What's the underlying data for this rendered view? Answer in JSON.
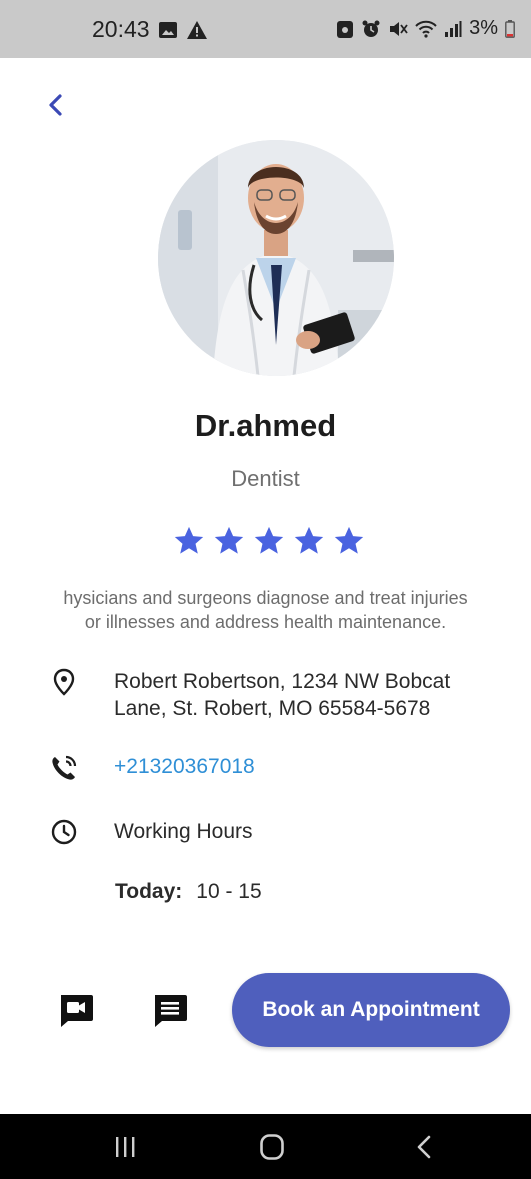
{
  "status_bar": {
    "time": "20:43",
    "battery": "3%"
  },
  "doctor": {
    "name": "Dr.ahmed",
    "specialty": "Dentist",
    "rating": 5,
    "rating_max": 5,
    "bio_line1": "hysicians and surgeons diagnose and treat injuries",
    "bio_line2": "or illnesses and address health maintenance.",
    "address_line1": "Robert Robertson, 1234 NW Bobcat",
    "address_line2": "Lane, St. Robert, MO 65584-5678",
    "phone": "+21320367018",
    "working_hours_label": "Working Hours",
    "today_label": "Today:",
    "today_hours": "10 - 15"
  },
  "actions": {
    "book_label": "Book an Appointment"
  },
  "colors": {
    "accent": "#4f5fbd",
    "star": "#4a63e0",
    "link": "#2f8fd6"
  },
  "icons": [
    "back-chevron-icon",
    "location-pin-icon",
    "phone-call-icon",
    "clock-icon",
    "video-call-icon",
    "chat-icon",
    "star-icon"
  ]
}
